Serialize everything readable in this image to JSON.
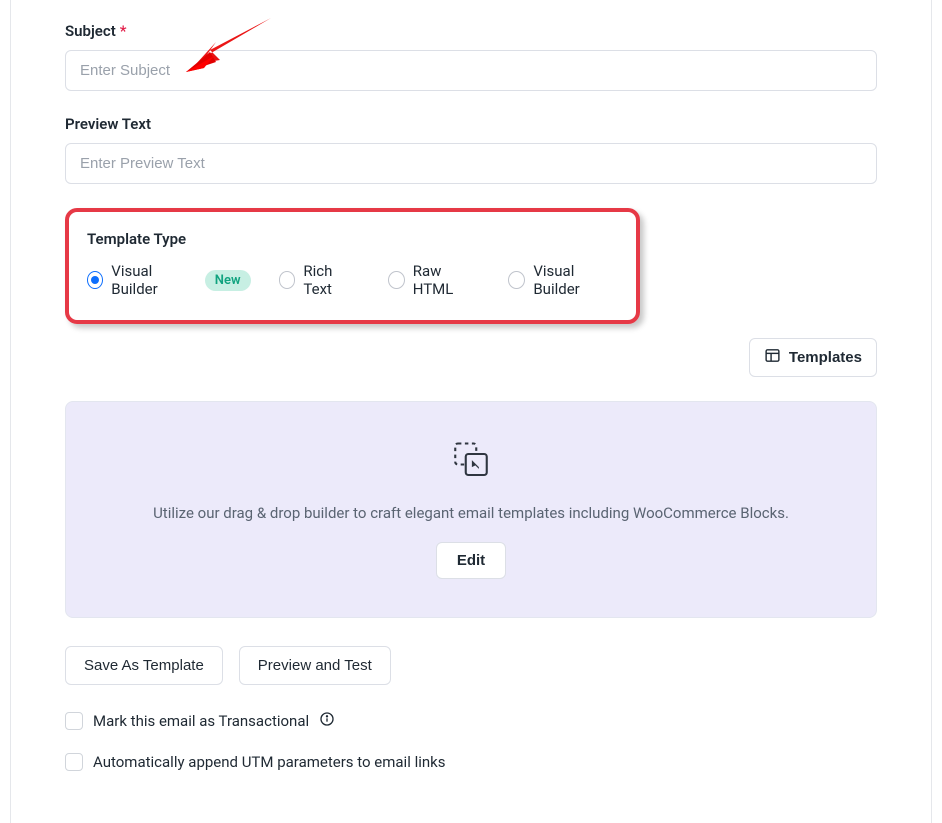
{
  "subject": {
    "label": "Subject",
    "required_mark": "*",
    "placeholder": "Enter Subject"
  },
  "preview_text": {
    "label": "Preview Text",
    "placeholder": "Enter Preview Text"
  },
  "template_type": {
    "label": "Template Type",
    "selected_index": 0,
    "options": [
      {
        "label": "Visual Builder",
        "badge": "New",
        "selected": true
      },
      {
        "label": "Rich Text"
      },
      {
        "label": "Raw HTML"
      },
      {
        "label": "Visual Builder"
      }
    ]
  },
  "templates_button": "Templates",
  "builder": {
    "description": "Utilize our drag & drop builder to craft elegant email templates including WooCommerce Blocks.",
    "edit_label": "Edit"
  },
  "actions": {
    "save_template": "Save As Template",
    "preview_test": "Preview and Test"
  },
  "checkboxes": {
    "transactional": "Mark this email as Transactional",
    "utm": "Automatically append UTM parameters to email links"
  }
}
